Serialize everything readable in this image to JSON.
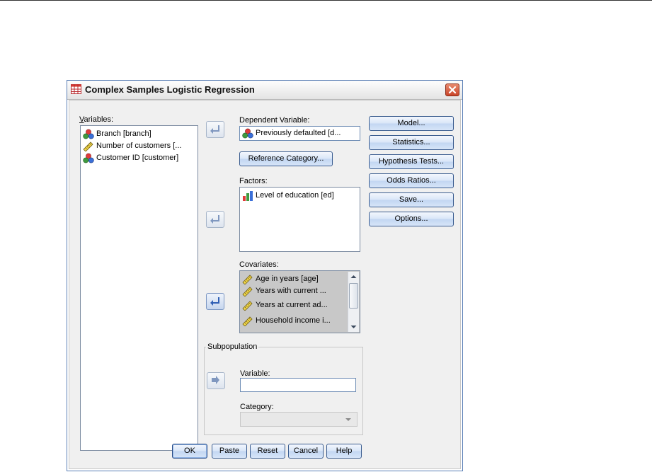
{
  "dialog": {
    "title": "Complex Samples Logistic Regression"
  },
  "variables": {
    "label": "Variables:",
    "items": [
      {
        "label": "Branch [branch]",
        "icon": "nominal-icon"
      },
      {
        "label": "Number of customers [...",
        "icon": "scale-icon"
      },
      {
        "label": "Customer ID [customer]",
        "icon": "nominal-icon"
      }
    ]
  },
  "dependent": {
    "label": "Dependent Variable:",
    "value": "Previously defaulted [d...",
    "reference_button": "Reference Category..."
  },
  "factors": {
    "label": "Factors:",
    "items": [
      {
        "label": "Level of education [ed]",
        "icon": "ordinal-icon"
      }
    ]
  },
  "covariates": {
    "label": "Covariates:",
    "items": [
      {
        "label": "Age in years [age]",
        "icon": "scale-icon"
      },
      {
        "label": "Years with current ...",
        "icon": "scale-icon"
      },
      {
        "label": "Years at current ad...",
        "icon": "scale-icon"
      },
      {
        "label": "Household income i...",
        "icon": "scale-icon"
      }
    ]
  },
  "subpopulation": {
    "label": "Subpopulation",
    "variable_label": "Variable:",
    "variable_value": "",
    "category_label": "Category:",
    "category_value": ""
  },
  "side_buttons": [
    "Model...",
    "Statistics...",
    "Hypothesis Tests...",
    "Odds Ratios...",
    "Save...",
    "Options..."
  ],
  "bottom_buttons": [
    "OK",
    "Paste",
    "Reset",
    "Cancel",
    "Help"
  ],
  "colors": {
    "button_border": "#3a5c8f",
    "selection": "#c0c0c0",
    "close": "#c9452a"
  }
}
